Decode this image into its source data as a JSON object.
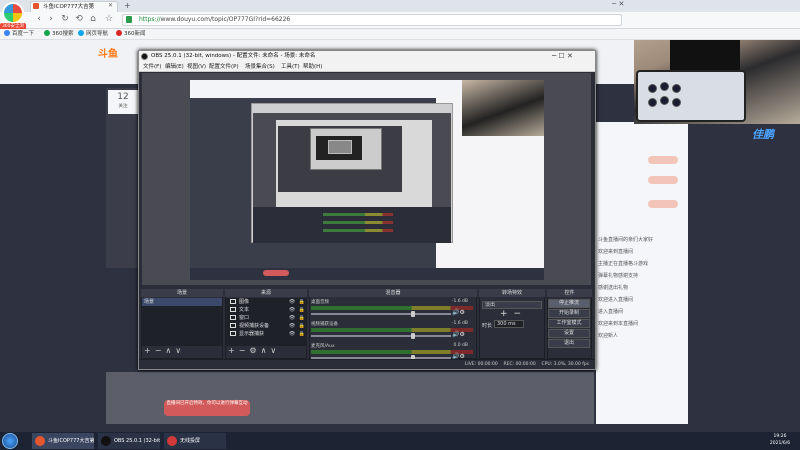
{
  "browser": {
    "logo_label": "360安全浏览器",
    "tab_title": "斗鱼ICOP777大吉第",
    "url_prefix": "https://",
    "url_host": "www.douyu.com",
    "url_rest": "/topic/OP777GI?rid=66226",
    "bookmarks": [
      "百度一下",
      "360搜索",
      "网页导航",
      "360新闻"
    ],
    "nav_icons": [
      "back-icon",
      "forward-icon",
      "refresh-icon",
      "reload-icon",
      "home-icon",
      "star-icon"
    ]
  },
  "page": {
    "logo_text": "斗鱼",
    "viewer_count": "12",
    "viewer_caption": "关注",
    "badge_text": "佳鹏",
    "red_note": "直播间已开启特效，你可以进行弹幕互动",
    "chat_lines": [
      "斗鱼直播间的亲们大家好",
      "欢迎来到直播间",
      "主播正在直播格斗游戏",
      "弹幕礼物感谢支持",
      "感谢送出礼物",
      "欢迎进入直播间",
      "进入直播间",
      "欢迎来到本直播间",
      "欢迎新人"
    ]
  },
  "obs": {
    "title": "OBS 25.0.1 (32-bit, windows) - 配置文件: 未命名 - 场景: 未命名",
    "menu": [
      "文件(F)",
      "编辑(E)",
      "视图(V)",
      "配置文件(P)",
      "场景集合(S)",
      "工具(T)",
      "帮助(H)"
    ],
    "docks": {
      "scenes": "场景",
      "sources": "来源",
      "mixer": "混音器",
      "transitions": "转场特效",
      "controls": "控件"
    },
    "scene_items": [
      "场景"
    ],
    "source_items": [
      {
        "label": "图像",
        "icon": "image-icon"
      },
      {
        "label": "文本",
        "icon": "text-icon"
      },
      {
        "label": "窗口",
        "icon": "window-icon"
      },
      {
        "label": "视频捕获设备",
        "icon": "camera-icon"
      },
      {
        "label": "显示器捕获",
        "icon": "monitor-icon"
      }
    ],
    "mixer": [
      {
        "label": "桌面音频",
        "db": "-1.6 dB"
      },
      {
        "label": "视频捕获设备",
        "db": "-1.6 dB"
      },
      {
        "label": "麦克风/Aux",
        "db": "0.0 dB"
      }
    ],
    "transition_value": "淡出",
    "duration_label": "时长",
    "duration_value": "300 ms",
    "controls": [
      "停止推流",
      "开始录制",
      "工作室模式",
      "设置",
      "退出"
    ],
    "status": "LIVE: 00:00:00    REC: 00:00:00    CPU: 3.0%, 30.00 fps"
  },
  "taskbar": {
    "items": [
      {
        "label": "斗鱼ICOP777大吉第",
        "icon": "browser-icon",
        "color": "#e4572e"
      },
      {
        "label": "OBS 25.0.1 (32-bit)",
        "icon": "obs-icon",
        "color": "#111111"
      },
      {
        "label": "无线投屏",
        "icon": "cast-icon",
        "color": "#d33a3a"
      }
    ],
    "time": "19:26",
    "date": "2021/6/6"
  }
}
